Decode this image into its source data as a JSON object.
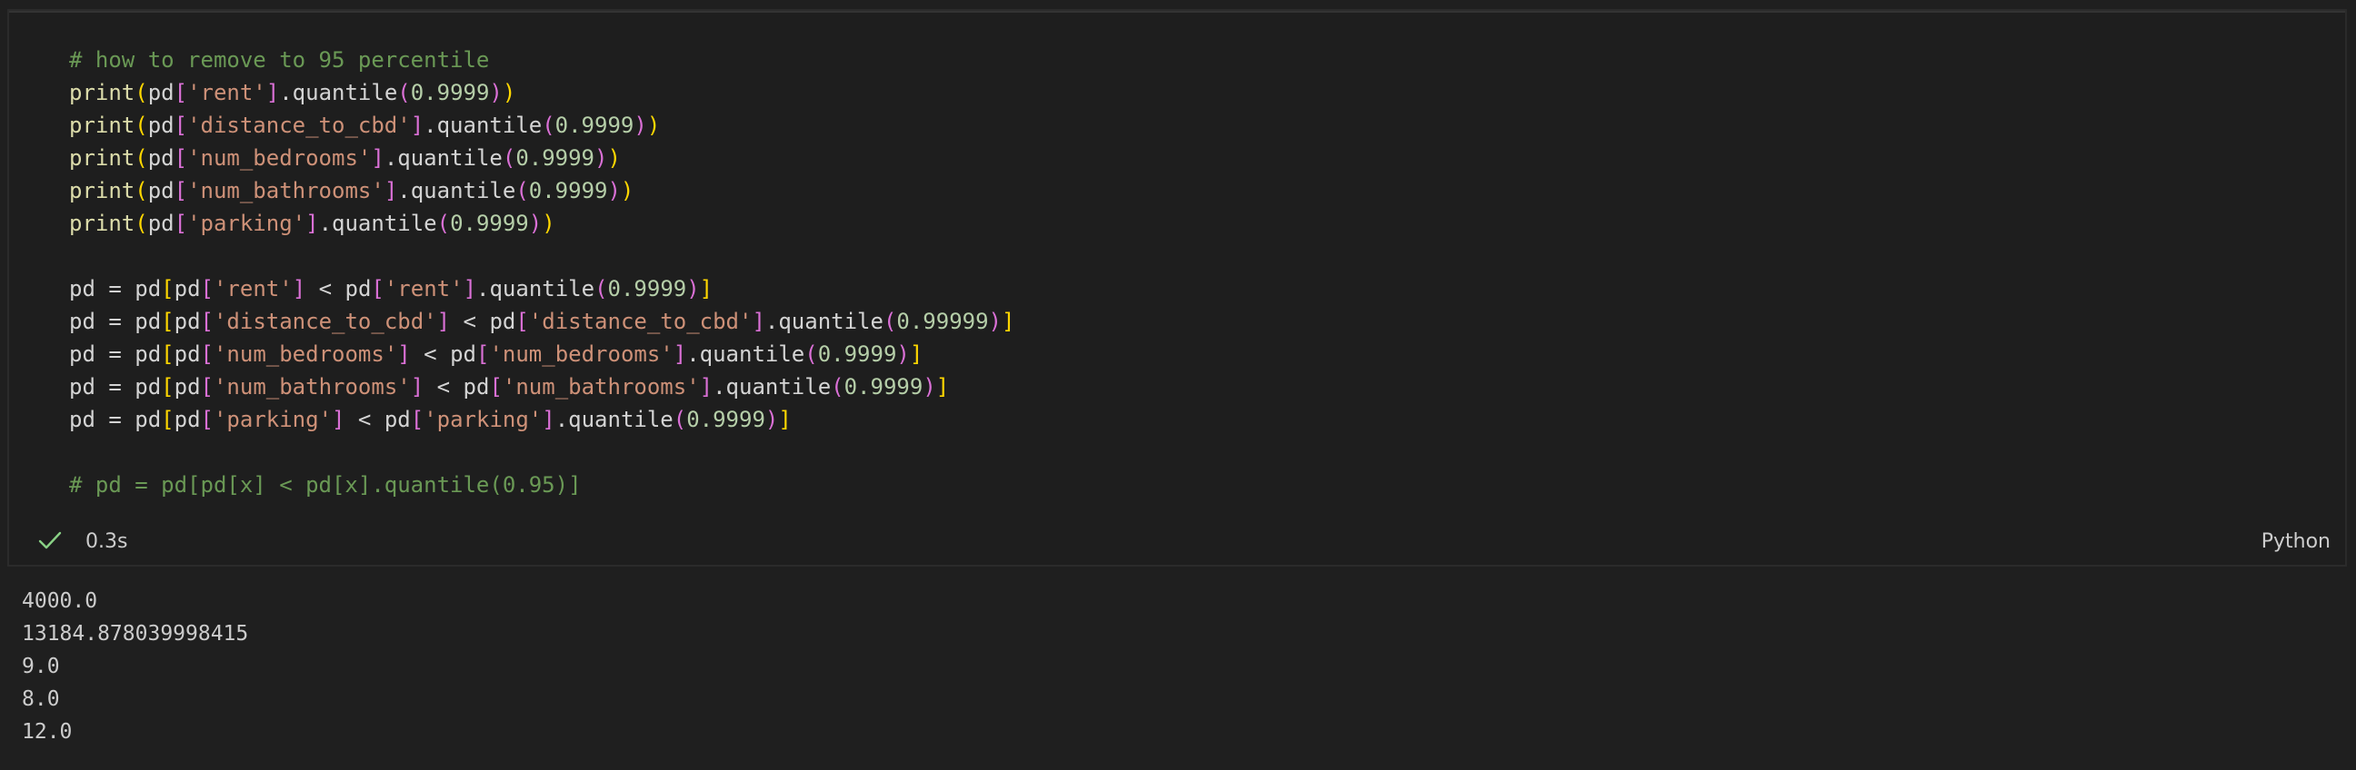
{
  "cell": {
    "lines": [
      [
        {
          "t": "# how to remove to 95 percentile",
          "c": "com"
        }
      ],
      [
        {
          "t": "print",
          "c": "fn"
        },
        {
          "t": "(",
          "c": "br1"
        },
        {
          "t": "pd",
          "c": "var"
        },
        {
          "t": "[",
          "c": "br2"
        },
        {
          "t": "'rent'",
          "c": "str"
        },
        {
          "t": "]",
          "c": "br2"
        },
        {
          "t": ".quantile",
          "c": "var"
        },
        {
          "t": "(",
          "c": "br2"
        },
        {
          "t": "0.9999",
          "c": "num"
        },
        {
          "t": ")",
          "c": "br2"
        },
        {
          "t": ")",
          "c": "br1"
        }
      ],
      [
        {
          "t": "print",
          "c": "fn"
        },
        {
          "t": "(",
          "c": "br1"
        },
        {
          "t": "pd",
          "c": "var"
        },
        {
          "t": "[",
          "c": "br2"
        },
        {
          "t": "'distance_to_cbd'",
          "c": "str"
        },
        {
          "t": "]",
          "c": "br2"
        },
        {
          "t": ".quantile",
          "c": "var"
        },
        {
          "t": "(",
          "c": "br2"
        },
        {
          "t": "0.9999",
          "c": "num"
        },
        {
          "t": ")",
          "c": "br2"
        },
        {
          "t": ")",
          "c": "br1"
        }
      ],
      [
        {
          "t": "print",
          "c": "fn"
        },
        {
          "t": "(",
          "c": "br1"
        },
        {
          "t": "pd",
          "c": "var"
        },
        {
          "t": "[",
          "c": "br2"
        },
        {
          "t": "'num_bedrooms'",
          "c": "str"
        },
        {
          "t": "]",
          "c": "br2"
        },
        {
          "t": ".quantile",
          "c": "var"
        },
        {
          "t": "(",
          "c": "br2"
        },
        {
          "t": "0.9999",
          "c": "num"
        },
        {
          "t": ")",
          "c": "br2"
        },
        {
          "t": ")",
          "c": "br1"
        }
      ],
      [
        {
          "t": "print",
          "c": "fn"
        },
        {
          "t": "(",
          "c": "br1"
        },
        {
          "t": "pd",
          "c": "var"
        },
        {
          "t": "[",
          "c": "br2"
        },
        {
          "t": "'num_bathrooms'",
          "c": "str"
        },
        {
          "t": "]",
          "c": "br2"
        },
        {
          "t": ".quantile",
          "c": "var"
        },
        {
          "t": "(",
          "c": "br2"
        },
        {
          "t": "0.9999",
          "c": "num"
        },
        {
          "t": ")",
          "c": "br2"
        },
        {
          "t": ")",
          "c": "br1"
        }
      ],
      [
        {
          "t": "print",
          "c": "fn"
        },
        {
          "t": "(",
          "c": "br1"
        },
        {
          "t": "pd",
          "c": "var"
        },
        {
          "t": "[",
          "c": "br2"
        },
        {
          "t": "'parking'",
          "c": "str"
        },
        {
          "t": "]",
          "c": "br2"
        },
        {
          "t": ".quantile",
          "c": "var"
        },
        {
          "t": "(",
          "c": "br2"
        },
        {
          "t": "0.9999",
          "c": "num"
        },
        {
          "t": ")",
          "c": "br2"
        },
        {
          "t": ")",
          "c": "br1"
        }
      ],
      [],
      [
        {
          "t": "pd ",
          "c": "var"
        },
        {
          "t": "=",
          "c": "op"
        },
        {
          "t": " pd",
          "c": "var"
        },
        {
          "t": "[",
          "c": "br1"
        },
        {
          "t": "pd",
          "c": "var"
        },
        {
          "t": "[",
          "c": "br2"
        },
        {
          "t": "'rent'",
          "c": "str"
        },
        {
          "t": "]",
          "c": "br2"
        },
        {
          "t": " < ",
          "c": "op"
        },
        {
          "t": "pd",
          "c": "var"
        },
        {
          "t": "[",
          "c": "br2"
        },
        {
          "t": "'rent'",
          "c": "str"
        },
        {
          "t": "]",
          "c": "br2"
        },
        {
          "t": ".quantile",
          "c": "var"
        },
        {
          "t": "(",
          "c": "br2"
        },
        {
          "t": "0.9999",
          "c": "num"
        },
        {
          "t": ")",
          "c": "br2"
        },
        {
          "t": "]",
          "c": "br1"
        }
      ],
      [
        {
          "t": "pd ",
          "c": "var"
        },
        {
          "t": "=",
          "c": "op"
        },
        {
          "t": " pd",
          "c": "var"
        },
        {
          "t": "[",
          "c": "br1"
        },
        {
          "t": "pd",
          "c": "var"
        },
        {
          "t": "[",
          "c": "br2"
        },
        {
          "t": "'distance_to_cbd'",
          "c": "str"
        },
        {
          "t": "]",
          "c": "br2"
        },
        {
          "t": " < ",
          "c": "op"
        },
        {
          "t": "pd",
          "c": "var"
        },
        {
          "t": "[",
          "c": "br2"
        },
        {
          "t": "'distance_to_cbd'",
          "c": "str"
        },
        {
          "t": "]",
          "c": "br2"
        },
        {
          "t": ".quantile",
          "c": "var"
        },
        {
          "t": "(",
          "c": "br2"
        },
        {
          "t": "0.99999",
          "c": "num"
        },
        {
          "t": ")",
          "c": "br2"
        },
        {
          "t": "]",
          "c": "br1"
        }
      ],
      [
        {
          "t": "pd ",
          "c": "var"
        },
        {
          "t": "=",
          "c": "op"
        },
        {
          "t": " pd",
          "c": "var"
        },
        {
          "t": "[",
          "c": "br1"
        },
        {
          "t": "pd",
          "c": "var"
        },
        {
          "t": "[",
          "c": "br2"
        },
        {
          "t": "'num_bedrooms'",
          "c": "str"
        },
        {
          "t": "]",
          "c": "br2"
        },
        {
          "t": " < ",
          "c": "op"
        },
        {
          "t": "pd",
          "c": "var"
        },
        {
          "t": "[",
          "c": "br2"
        },
        {
          "t": "'num_bedrooms'",
          "c": "str"
        },
        {
          "t": "]",
          "c": "br2"
        },
        {
          "t": ".quantile",
          "c": "var"
        },
        {
          "t": "(",
          "c": "br2"
        },
        {
          "t": "0.9999",
          "c": "num"
        },
        {
          "t": ")",
          "c": "br2"
        },
        {
          "t": "]",
          "c": "br1"
        }
      ],
      [
        {
          "t": "pd ",
          "c": "var"
        },
        {
          "t": "=",
          "c": "op"
        },
        {
          "t": " pd",
          "c": "var"
        },
        {
          "t": "[",
          "c": "br1"
        },
        {
          "t": "pd",
          "c": "var"
        },
        {
          "t": "[",
          "c": "br2"
        },
        {
          "t": "'num_bathrooms'",
          "c": "str"
        },
        {
          "t": "]",
          "c": "br2"
        },
        {
          "t": " < ",
          "c": "op"
        },
        {
          "t": "pd",
          "c": "var"
        },
        {
          "t": "[",
          "c": "br2"
        },
        {
          "t": "'num_bathrooms'",
          "c": "str"
        },
        {
          "t": "]",
          "c": "br2"
        },
        {
          "t": ".quantile",
          "c": "var"
        },
        {
          "t": "(",
          "c": "br2"
        },
        {
          "t": "0.9999",
          "c": "num"
        },
        {
          "t": ")",
          "c": "br2"
        },
        {
          "t": "]",
          "c": "br1"
        }
      ],
      [
        {
          "t": "pd ",
          "c": "var"
        },
        {
          "t": "=",
          "c": "op"
        },
        {
          "t": " pd",
          "c": "var"
        },
        {
          "t": "[",
          "c": "br1"
        },
        {
          "t": "pd",
          "c": "var"
        },
        {
          "t": "[",
          "c": "br2"
        },
        {
          "t": "'parking'",
          "c": "str"
        },
        {
          "t": "]",
          "c": "br2"
        },
        {
          "t": " < ",
          "c": "op"
        },
        {
          "t": "pd",
          "c": "var"
        },
        {
          "t": "[",
          "c": "br2"
        },
        {
          "t": "'parking'",
          "c": "str"
        },
        {
          "t": "]",
          "c": "br2"
        },
        {
          "t": ".quantile",
          "c": "var"
        },
        {
          "t": "(",
          "c": "br2"
        },
        {
          "t": "0.9999",
          "c": "num"
        },
        {
          "t": ")",
          "c": "br2"
        },
        {
          "t": "]",
          "c": "br1"
        }
      ],
      [],
      [
        {
          "t": "# pd = pd[pd[x] < pd[x].quantile(0.95)]",
          "c": "com"
        }
      ]
    ],
    "status_icon": "check-icon",
    "exec_time": "0.3s",
    "language": "Python"
  },
  "output": {
    "lines": [
      "4000.0",
      "13184.878039998415",
      "9.0",
      "8.0",
      "12.0"
    ]
  },
  "colors": {
    "background": "#1f1f1f",
    "cell_background": "#1e1e1e",
    "comment": "#6a9955",
    "string": "#ce9178",
    "number": "#b5cea8",
    "function": "#dcdcaa",
    "bracket_outer": "#ffd700",
    "bracket_inner": "#da70d6",
    "success": "#89d185"
  }
}
